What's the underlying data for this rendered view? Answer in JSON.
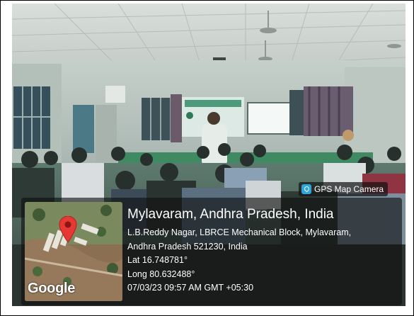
{
  "camera_badge": {
    "label": "GPS Map Camera",
    "icon": "gps-map-camera-icon"
  },
  "location_card": {
    "title": "Mylavaram, Andhra Pradesh, India",
    "address_line_1": "L.B.Reddy Nagar, LBRCE Mechanical Block, Mylavaram,",
    "address_line_2": "Andhra Pradesh 521230, India",
    "latitude": "Lat 16.748781°",
    "longitude": "Long 80.632488°",
    "datetime": "07/03/23 09:57 AM GMT +05:30"
  },
  "map_thumbnail": {
    "watermark": "Google",
    "marker_color": "#e53935"
  },
  "colors": {
    "overlay": "#0f0f0f",
    "badge_icon": "#2ea6d9"
  }
}
